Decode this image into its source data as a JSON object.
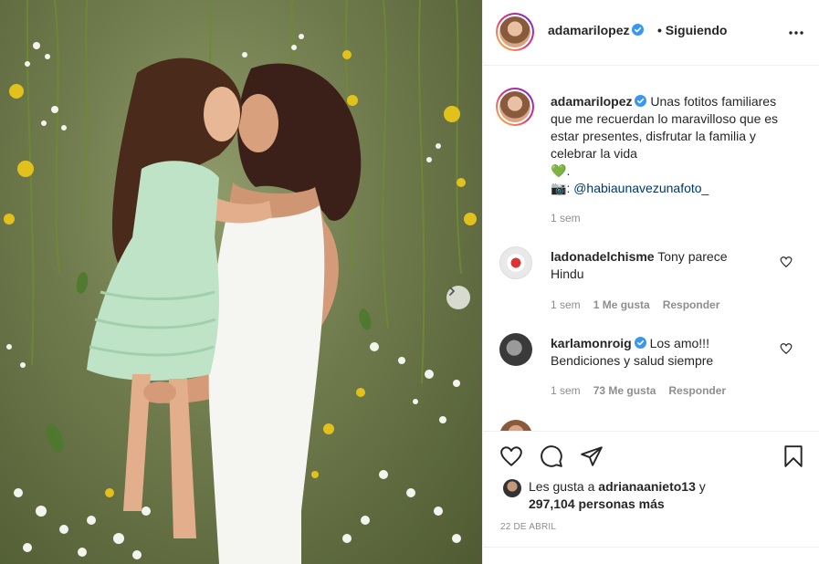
{
  "header": {
    "username": "adamarilopez",
    "separator": "•",
    "follow_status": "Siguiendo",
    "more_icon": "more-horizontal-icon"
  },
  "caption": {
    "username": "adamarilopez",
    "text": "Unas fotitos familiares que me recuerdan lo maravilloso que es estar presentes, disfrutar la familia y celebrar la vida",
    "emoji_heart": "💚",
    "period": ".",
    "camera_emoji": "📷",
    "colon": ":",
    "mention": "@habiaunavezunafoto_",
    "time": "1 sem"
  },
  "comments": [
    {
      "username": "ladonadelchisme",
      "text": "Tony parece Hindu",
      "time": "1 sem",
      "likes": "1 Me gusta",
      "reply": "Responder"
    },
    {
      "username": "karlamonroig",
      "text": "Los amo!!! Bendiciones y salud siempre",
      "time": "1 sem",
      "likes": "73 Me gusta",
      "reply": "Responder"
    }
  ],
  "actions": {
    "like_icon": "heart-icon",
    "comment_icon": "comment-icon",
    "share_icon": "paper-plane-icon",
    "save_icon": "bookmark-icon"
  },
  "likes": {
    "prefix": "Les gusta a",
    "user": "adrianaanieto13",
    "middle": "y",
    "count": "297,104 personas más"
  },
  "date": "22 DE ABRIL",
  "colors": {
    "verified": "#3897f0",
    "text": "#262626",
    "muted": "#8e8e8e",
    "link": "#00376b"
  }
}
